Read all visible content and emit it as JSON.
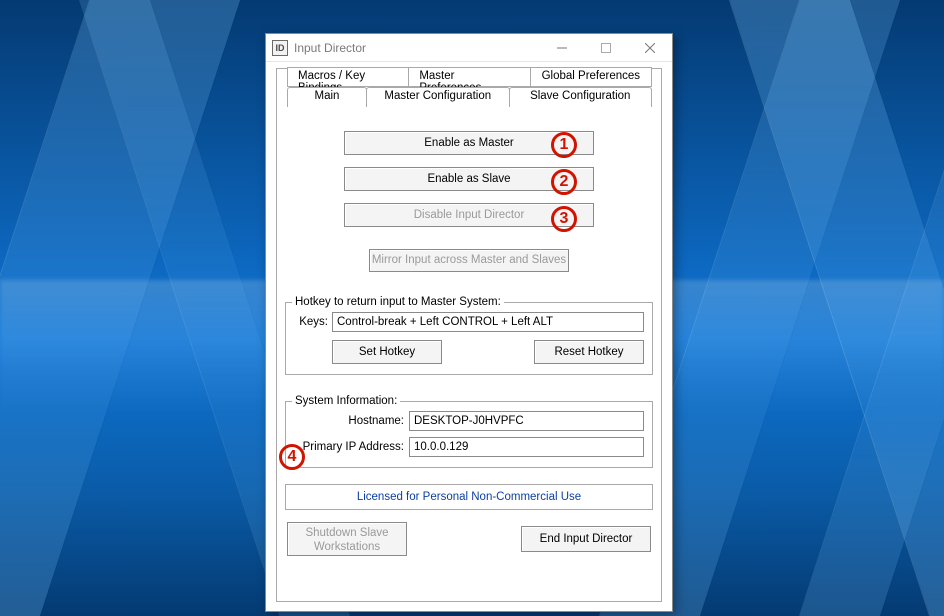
{
  "window": {
    "title": "Input Director",
    "icon_label": "ID"
  },
  "tabs": {
    "row_top": [
      {
        "label": "Macros / Key Bindings"
      },
      {
        "label": "Master Preferences"
      },
      {
        "label": "Global Preferences"
      }
    ],
    "row_bottom": [
      {
        "label": "Main",
        "active": true
      },
      {
        "label": "Master Configuration"
      },
      {
        "label": "Slave Configuration"
      }
    ]
  },
  "main": {
    "enable_master_label": "Enable as Master",
    "enable_slave_label": "Enable as Slave",
    "disable_label": "Disable Input Director",
    "mirror_label": "Mirror Input across Master and Slaves"
  },
  "hotkey": {
    "legend": "Hotkey to return input to Master System:",
    "keys_label": "Keys:",
    "keys_value": "Control-break + Left CONTROL + Left ALT",
    "set_label": "Set Hotkey",
    "reset_label": "Reset Hotkey"
  },
  "sysinfo": {
    "legend": "System Information:",
    "hostname_label": "Hostname:",
    "hostname_value": "DESKTOP-J0HVPFC",
    "ip_label": "Primary IP Address:",
    "ip_value": "10.0.0.129"
  },
  "license_label": "Licensed for Personal Non-Commercial Use",
  "footer": {
    "shutdown_label": "Shutdown Slave\nWorkstations",
    "end_label": "End Input Director"
  },
  "annotations": {
    "a1": "1",
    "a2": "2",
    "a3": "3",
    "a4": "4"
  }
}
